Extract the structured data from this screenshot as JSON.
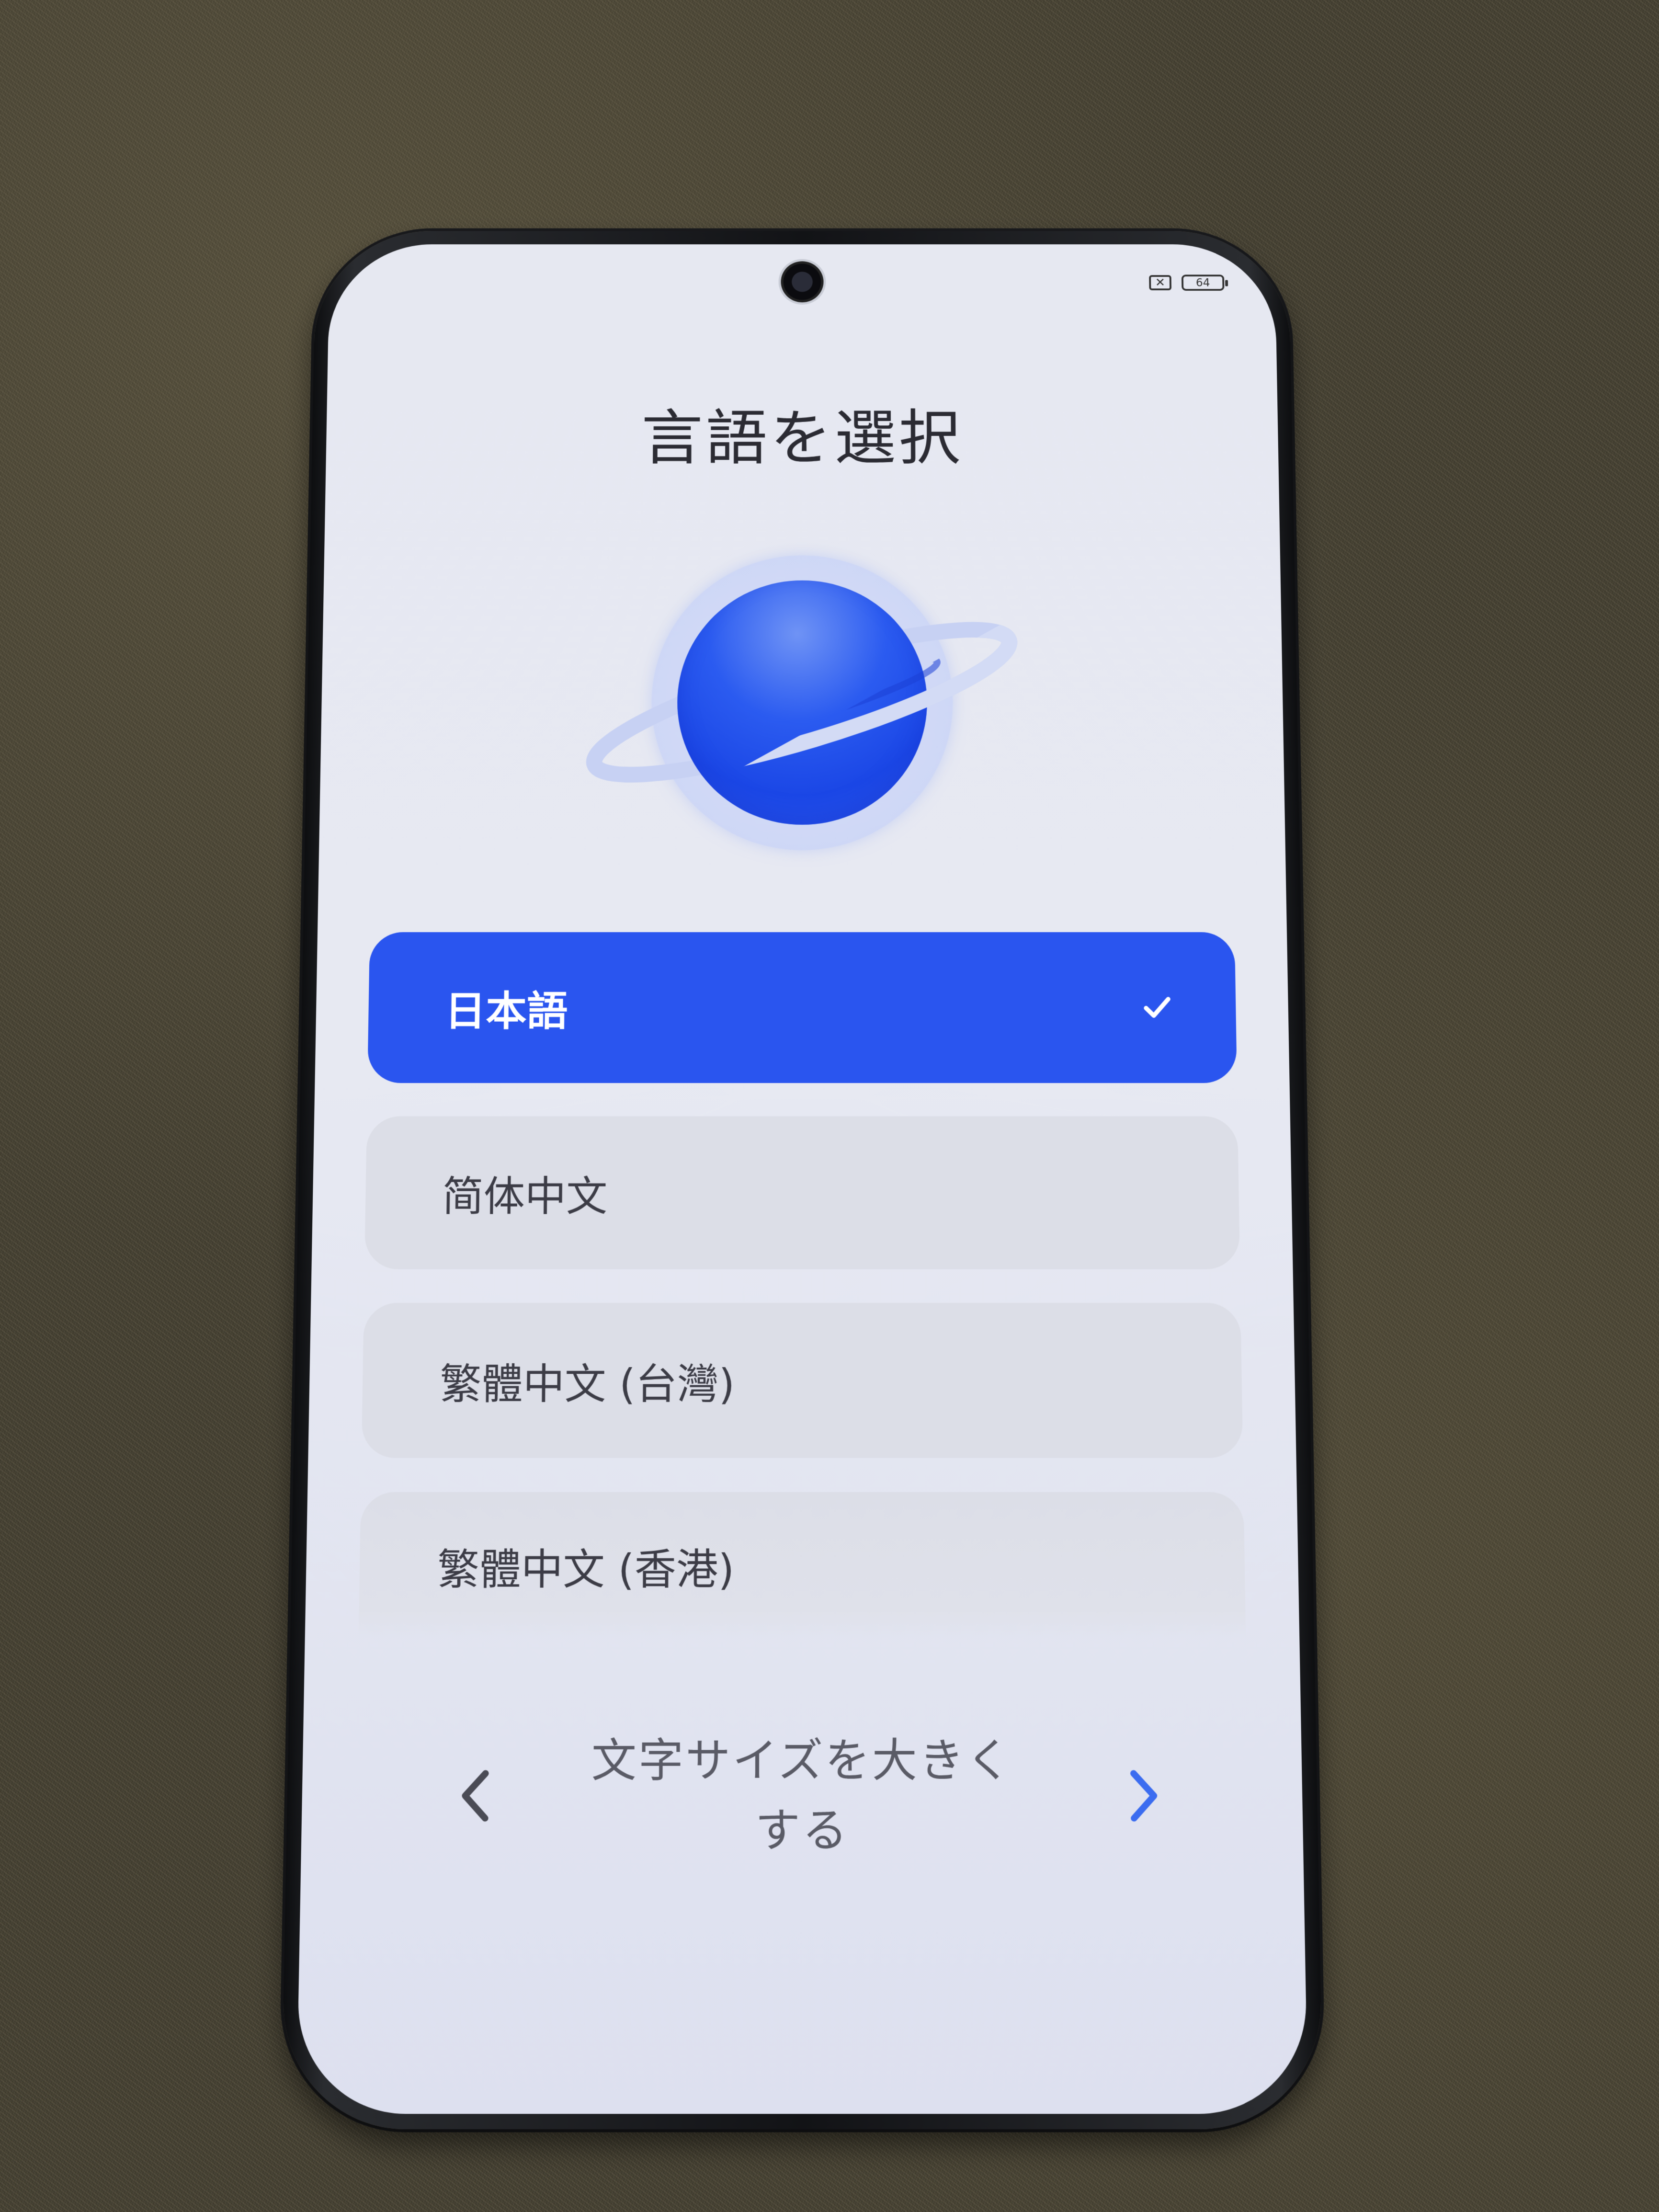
{
  "status_bar": {
    "sim_icon": "no-sim-icon",
    "sim_symbol": "✕",
    "battery_icon": "battery-icon",
    "battery_level": "64"
  },
  "screen": {
    "title": "言語を選択",
    "illustration": "planet-icon"
  },
  "languages": [
    {
      "label": "日本語",
      "selected": true
    },
    {
      "label": "简体中文",
      "selected": false
    },
    {
      "label": "繁體中文 (台灣)",
      "selected": false
    },
    {
      "label": "繁體中文 (香港)",
      "selected": false
    }
  ],
  "bottom_nav": {
    "back_icon": "chevron-left-icon",
    "next_icon": "chevron-right-icon",
    "font_size_label": "文字サイズを大きくする"
  },
  "colors": {
    "accent": "#2a55ef",
    "item_bg": "#dcdee7",
    "screen_bg": "#e6e8f1",
    "next_arrow": "#3b6cf0",
    "back_arrow": "#4a4b55"
  }
}
